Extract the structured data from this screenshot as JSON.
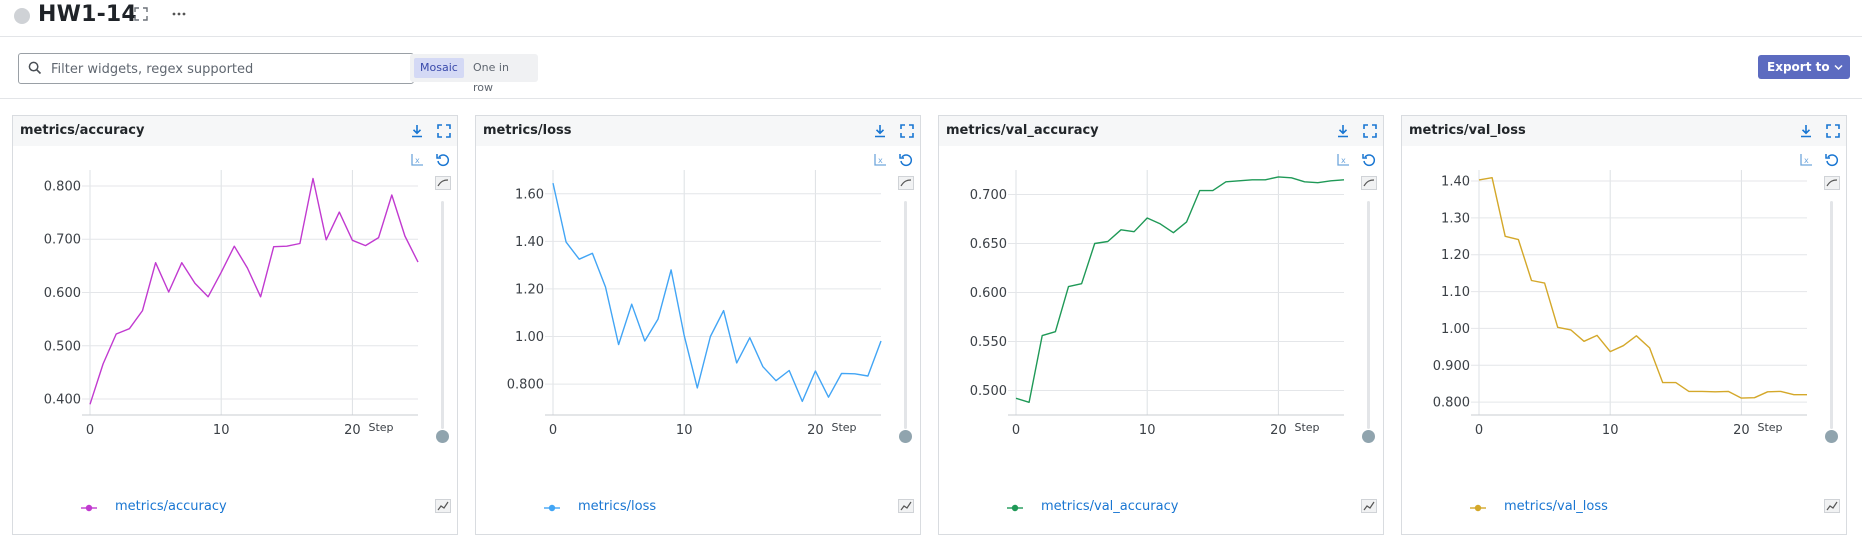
{
  "header": {
    "title": "HW1-14"
  },
  "toolbar": {
    "search_placeholder": "Filter widgets, regex supported",
    "view_options": [
      "Mosaic",
      "One in row"
    ],
    "active_view": "Mosaic",
    "export_label": "Export to"
  },
  "colors": {
    "accent": "#5c6bc0",
    "link": "#1976d2"
  },
  "panels": [
    {
      "title": "metrics/accuracy",
      "legend": "metrics/accuracy",
      "color": "#c13ad0",
      "yticks": [
        "0.400",
        "0.500",
        "0.600",
        "0.700",
        "0.800"
      ],
      "xticks": [
        "0",
        "10",
        "20"
      ],
      "step_label": "Step"
    },
    {
      "title": "metrics/loss",
      "legend": "metrics/loss",
      "color": "#42a5f5",
      "yticks": [
        "0.800",
        "1.00",
        "1.20",
        "1.40",
        "1.60"
      ],
      "xticks": [
        "0",
        "10",
        "20"
      ],
      "step_label": "Step"
    },
    {
      "title": "metrics/val_accuracy",
      "legend": "metrics/val_accuracy",
      "color": "#1f9957",
      "yticks": [
        "0.500",
        "0.550",
        "0.600",
        "0.650",
        "0.700"
      ],
      "xticks": [
        "0",
        "10",
        "20"
      ],
      "step_label": "Step"
    },
    {
      "title": "metrics/val_loss",
      "legend": "metrics/val_loss",
      "color": "#d4a82a",
      "yticks": [
        "0.800",
        "0.900",
        "1.00",
        "1.10",
        "1.20",
        "1.30",
        "1.40"
      ],
      "xticks": [
        "0",
        "10",
        "20"
      ],
      "step_label": "Step"
    }
  ],
  "chart_data": [
    {
      "type": "line",
      "title": "metrics/accuracy",
      "xlabel": "Step",
      "ylabel": "",
      "xlim": [
        0,
        25
      ],
      "ylim": [
        0.37,
        0.83
      ],
      "grid": true,
      "legend": "bottom",
      "series": [
        {
          "name": "metrics/accuracy",
          "x": [
            0,
            1,
            2,
            3,
            4,
            5,
            6,
            7,
            8,
            9,
            10,
            11,
            12,
            13,
            14,
            15,
            16,
            17,
            18,
            19,
            20,
            21,
            22,
            23,
            24,
            25
          ],
          "values": [
            0.39,
            0.466,
            0.522,
            0.532,
            0.566,
            0.656,
            0.601,
            0.656,
            0.617,
            0.592,
            0.638,
            0.687,
            0.646,
            0.592,
            0.686,
            0.687,
            0.692,
            0.814,
            0.699,
            0.751,
            0.698,
            0.688,
            0.703,
            0.783,
            0.706,
            0.657
          ]
        }
      ]
    },
    {
      "type": "line",
      "title": "metrics/loss",
      "xlabel": "Step",
      "ylabel": "",
      "xlim": [
        0,
        25
      ],
      "ylim": [
        0.67,
        1.7
      ],
      "grid": true,
      "legend": "bottom",
      "series": [
        {
          "name": "metrics/loss",
          "x": [
            0,
            1,
            2,
            3,
            4,
            5,
            6,
            7,
            8,
            9,
            10,
            11,
            12,
            13,
            14,
            15,
            16,
            17,
            18,
            19,
            20,
            21,
            22,
            23,
            24,
            25
          ],
          "values": [
            1.645,
            1.397,
            1.325,
            1.35,
            1.208,
            0.966,
            1.136,
            0.981,
            1.073,
            1.28,
            1.004,
            0.784,
            1.0,
            1.109,
            0.889,
            0.995,
            0.873,
            0.814,
            0.857,
            0.727,
            0.855,
            0.745,
            0.845,
            0.843,
            0.834,
            0.981
          ]
        }
      ]
    },
    {
      "type": "line",
      "title": "metrics/val_accuracy",
      "xlabel": "Step",
      "ylabel": "",
      "xlim": [
        0,
        25
      ],
      "ylim": [
        0.475,
        0.725
      ],
      "grid": true,
      "legend": "bottom",
      "series": [
        {
          "name": "metrics/val_accuracy",
          "x": [
            0,
            1,
            2,
            3,
            4,
            5,
            6,
            7,
            8,
            9,
            10,
            11,
            12,
            13,
            14,
            15,
            16,
            17,
            18,
            19,
            20,
            21,
            22,
            23,
            24,
            25
          ],
          "values": [
            0.492,
            0.488,
            0.556,
            0.56,
            0.606,
            0.609,
            0.65,
            0.652,
            0.664,
            0.662,
            0.676,
            0.67,
            0.661,
            0.672,
            0.704,
            0.704,
            0.713,
            0.714,
            0.715,
            0.715,
            0.718,
            0.717,
            0.713,
            0.712,
            0.714,
            0.715
          ]
        }
      ]
    },
    {
      "type": "line",
      "title": "metrics/val_loss",
      "xlabel": "Step",
      "ylabel": "",
      "xlim": [
        0,
        25
      ],
      "ylim": [
        0.765,
        1.43
      ],
      "grid": true,
      "legend": "bottom",
      "series": [
        {
          "name": "metrics/val_loss",
          "x": [
            0,
            1,
            2,
            3,
            4,
            5,
            6,
            7,
            8,
            9,
            10,
            11,
            12,
            13,
            14,
            15,
            16,
            17,
            18,
            19,
            20,
            21,
            22,
            23,
            24,
            25
          ],
          "values": [
            1.403,
            1.409,
            1.25,
            1.241,
            1.13,
            1.123,
            1.003,
            0.996,
            0.965,
            0.981,
            0.937,
            0.953,
            0.98,
            0.947,
            0.853,
            0.853,
            0.829,
            0.829,
            0.828,
            0.829,
            0.811,
            0.812,
            0.828,
            0.829,
            0.82,
            0.82
          ]
        }
      ]
    }
  ]
}
